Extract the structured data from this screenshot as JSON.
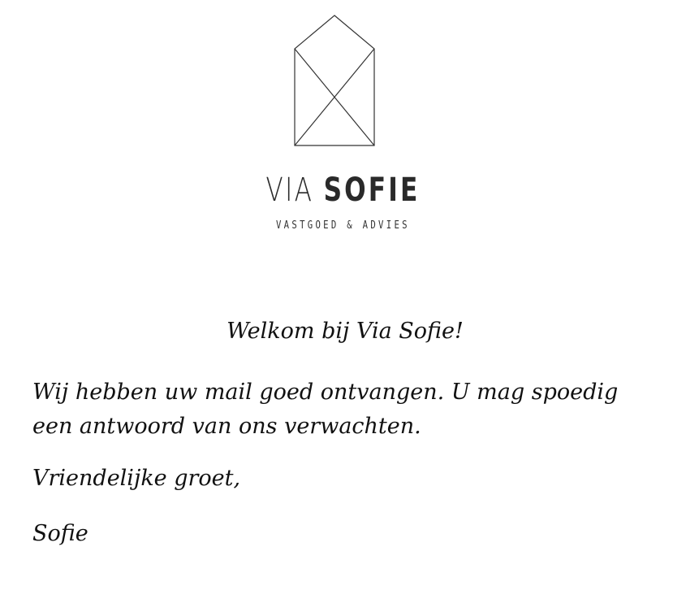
{
  "logo": {
    "icon": "house-outline-icon",
    "brand_thin": "VIA",
    "brand_bold": "SOFIE",
    "tagline": "VASTGOED & ADVIES"
  },
  "message": {
    "welcome": "Welkom bij Via Sofie!",
    "body": "Wij hebben uw mail goed ontvangen. U mag spoedig een antwoord van ons verwachten.",
    "greeting": "Vriendelijke groet,",
    "signature": "Sofie"
  }
}
